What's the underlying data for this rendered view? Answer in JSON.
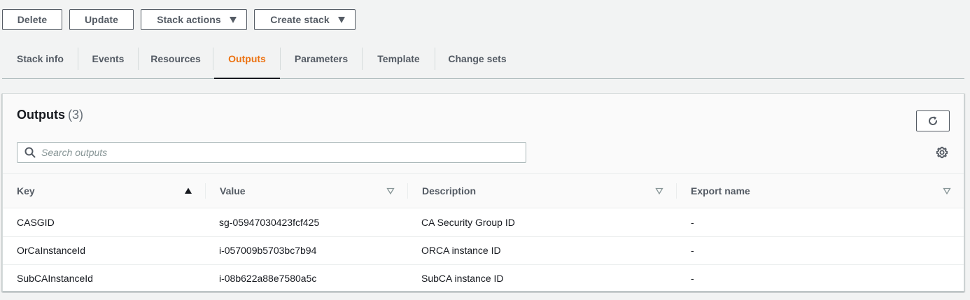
{
  "toolbar": {
    "delete_label": "Delete",
    "update_label": "Update",
    "stack_actions_label": "Stack actions",
    "create_stack_label": "Create stack"
  },
  "tabs": [
    {
      "label": "Stack info",
      "active": false
    },
    {
      "label": "Events",
      "active": false
    },
    {
      "label": "Resources",
      "active": false
    },
    {
      "label": "Outputs",
      "active": true
    },
    {
      "label": "Parameters",
      "active": false
    },
    {
      "label": "Template",
      "active": false
    },
    {
      "label": "Change sets",
      "active": false
    }
  ],
  "panel": {
    "title": "Outputs",
    "count": "(3)",
    "search_placeholder": "Search outputs",
    "search_value": "",
    "refresh_icon": "refresh-icon",
    "settings_icon": "gear-icon"
  },
  "table": {
    "columns": [
      {
        "label": "Key",
        "sort": "ascending"
      },
      {
        "label": "Value",
        "sort": "none"
      },
      {
        "label": "Description",
        "sort": "none"
      },
      {
        "label": "Export name",
        "sort": "none"
      }
    ],
    "rows": [
      {
        "key": "CASGID",
        "value": "sg-05947030423fcf425",
        "description": "CA Security Group ID",
        "export": "-"
      },
      {
        "key": "OrCaInstanceId",
        "value": "i-057009b5703bc7b94",
        "description": "ORCA instance ID",
        "export": "-"
      },
      {
        "key": "SubCAInstanceId",
        "value": "i-08b622a88e7580a5c",
        "description": "SubCA instance ID",
        "export": "-"
      }
    ]
  },
  "colors": {
    "accent": "#ec7211",
    "text": "#16191f",
    "muted": "#545b64",
    "background": "#f2f3f3"
  }
}
